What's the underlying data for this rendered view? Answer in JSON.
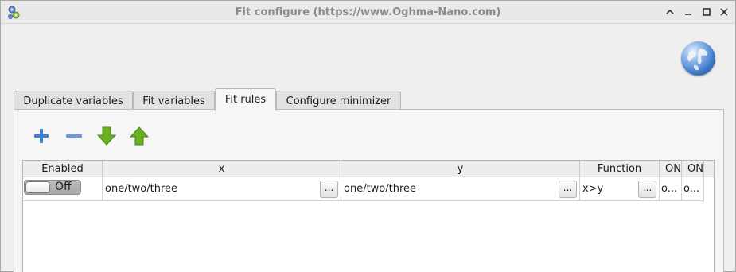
{
  "window": {
    "title": "Fit configure (https://www.Oghma-Nano.com)",
    "controls": {
      "collapse": "⌃",
      "minimize": "‒",
      "maximize": "□",
      "close": "✕"
    }
  },
  "tabs": [
    {
      "label": "Duplicate variables",
      "active": false
    },
    {
      "label": "Fit variables",
      "active": false
    },
    {
      "label": "Fit rules",
      "active": true
    },
    {
      "label": "Configure minimizer",
      "active": false
    }
  ],
  "toolbar": {
    "add_icon": "plus-icon",
    "remove_icon": "minus-icon",
    "down_icon": "arrow-down-icon",
    "up_icon": "arrow-up-icon"
  },
  "table": {
    "headers": [
      "Enabled",
      "x",
      "y",
      "Function",
      "ON",
      "ON"
    ],
    "rows": [
      {
        "enabled": "Off",
        "x": "one/two/three",
        "x_button": "...",
        "y": "one/two/three",
        "y_button": "...",
        "function": "x>y",
        "function_button": "...",
        "extra1": "o...",
        "extra2": "o..."
      }
    ]
  },
  "colors": {
    "plus": "#3b7fd1",
    "minus": "#3b7fd1",
    "arrow_down": "#6ab023",
    "arrow_up": "#6ab023",
    "globe": "#3d78c8"
  }
}
